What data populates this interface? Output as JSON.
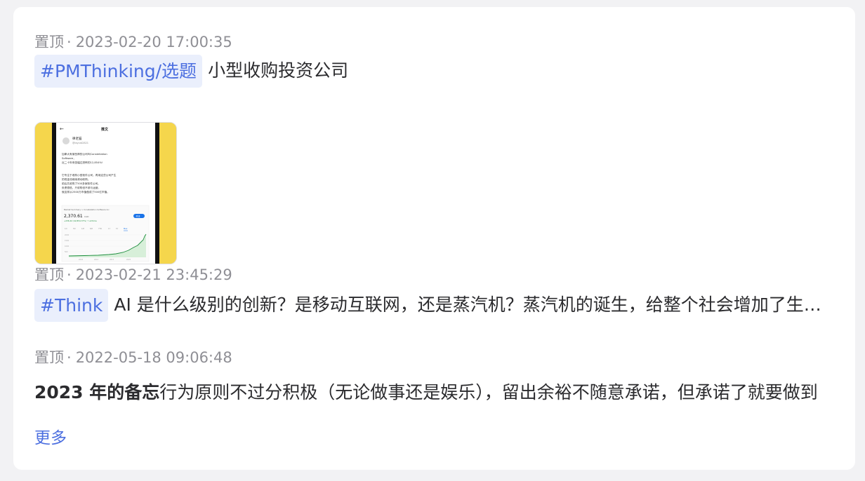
{
  "notes": [
    {
      "pinned": "置顶",
      "separator": "·",
      "timestamp": "2023-02-20 17:00:35",
      "tag": "#PMThinking/选题",
      "text": "小型收购投资公司",
      "image": {
        "header_title": "推文",
        "author": "律老猫",
        "handle": "@laycat2821",
        "lines": [
          "加拿大有家西神的公司叫Constellation",
          "Software，",
          "近二十年来涨幅达恐怖的12,854%!",
          "",
          "它专注于收购小型软件公司，再用这些公司产生",
          "的现金流继续滚动收购。",
          "前后共收购了500多家软件公司。",
          "负债很低，只收购但不参与运营，",
          "就这样从2500万市值做成了500亿市值。"
        ],
        "stock_caption": "Market Summary > Constellation Software Inc",
        "stock_price": "2,370.61",
        "stock_currency": "CAD",
        "stock_change": "+236.42 (42,854.37%) ↑ all time",
        "follow_label": "关注"
      }
    },
    {
      "pinned": "置顶",
      "separator": "·",
      "timestamp": "2023-02-21 23:45:29",
      "tag": "#Think",
      "text": "AI 是什么级别的创新？是移动互联网，还是蒸汽机？蒸汽机的诞生，给整个社会增加了生产力"
    },
    {
      "pinned": "置顶",
      "separator": "·",
      "timestamp": "2022-05-18 09:06:48",
      "bold_text": "2023 年的备忘",
      "text": "行为原则不过分积极（无论做事还是娱乐），留出余裕不随意承诺，但承诺了就要做到"
    }
  ],
  "more_label": "更多",
  "colors": {
    "accent": "#4c6fe0",
    "tag_bg": "#eaeffc",
    "meta": "#8f8f95",
    "text": "#2b2b2e"
  }
}
